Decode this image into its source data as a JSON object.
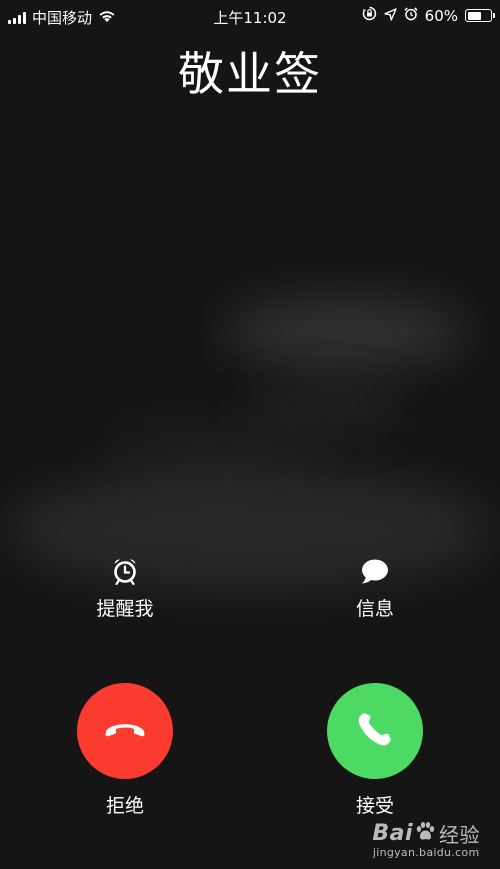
{
  "status_bar": {
    "carrier": "中国移动",
    "time": "上午11:02",
    "battery_percent": "60%",
    "battery_level": 0.6,
    "icons": [
      "signal-icon",
      "wifi-icon",
      "orientation-lock-icon",
      "location-icon",
      "alarm-icon",
      "battery-icon"
    ]
  },
  "caller": {
    "name": "敬业签"
  },
  "options": {
    "remind_me": {
      "label": "提醒我",
      "icon": "alarm-clock-icon"
    },
    "message": {
      "label": "信息",
      "icon": "message-bubble-icon"
    }
  },
  "call_actions": {
    "decline": {
      "label": "拒绝",
      "icon": "hang-up-icon",
      "color": "#fb3a30"
    },
    "accept": {
      "label": "接受",
      "icon": "phone-icon",
      "color": "#4cd964"
    }
  },
  "watermark": {
    "brand_prefix": "Bai",
    "brand_suffix": "经验",
    "url": "jingyan.baidu.com"
  }
}
